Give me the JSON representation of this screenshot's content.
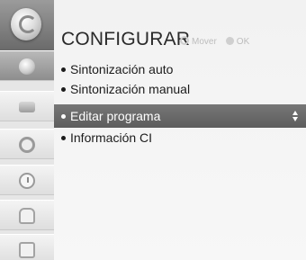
{
  "header": {
    "title": "CONFIGURAR",
    "hint_move": "Mover",
    "hint_ok": "OK"
  },
  "rail": {
    "logo_icon": "settings-disc-icon",
    "items": [
      {
        "icon": "satellite-dish-icon",
        "active": true
      },
      {
        "icon": "tv-picture-icon",
        "active": false
      },
      {
        "icon": "audio-dial-icon",
        "active": false
      },
      {
        "icon": "clock-icon",
        "active": false
      },
      {
        "icon": "lock-icon",
        "active": false
      },
      {
        "icon": "options-icon",
        "active": false
      }
    ]
  },
  "menu": {
    "items": [
      {
        "label": "Sintonización auto",
        "selected": false
      },
      {
        "label": "Sintonización manual",
        "selected": false
      },
      {
        "label": "Editar programa",
        "selected": true
      },
      {
        "label": "Información CI",
        "selected": false
      }
    ]
  },
  "colors": {
    "selection": "#6a6a6a",
    "rail_active": "#9a9a9a",
    "background": "#f4f4f4"
  }
}
